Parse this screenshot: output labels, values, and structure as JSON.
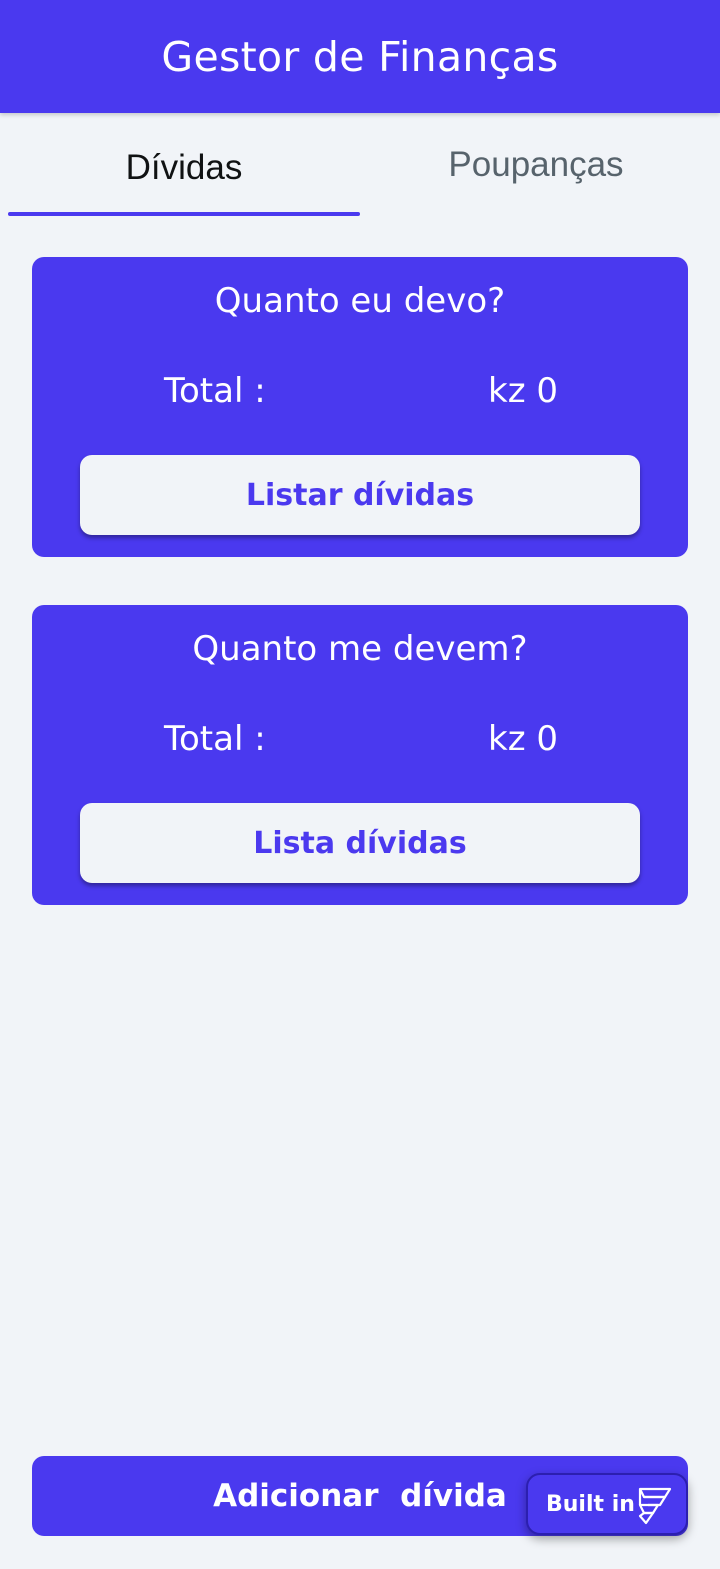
{
  "appbar": {
    "title": "Gestor de Finanças"
  },
  "tabs": [
    {
      "label": "Dívidas",
      "selected": true
    },
    {
      "label": "Poupanças",
      "selected": false
    }
  ],
  "cards": [
    {
      "title": "Quanto eu devo?",
      "total_label": "Total :",
      "total_value": "kz 0",
      "button_label": "Listar dívidas"
    },
    {
      "title": "Quanto me devem?",
      "total_label": "Total :",
      "total_value": "kz 0",
      "button_label": "Lista dívidas"
    }
  ],
  "add_button_label": "Adicionar  dívida",
  "badge": {
    "label": "Built in",
    "icon": "flutterflow-logo-icon"
  },
  "colors": {
    "primary": "#4a39ef",
    "background": "#f1f4f8",
    "button_text": "#4b39ef"
  }
}
